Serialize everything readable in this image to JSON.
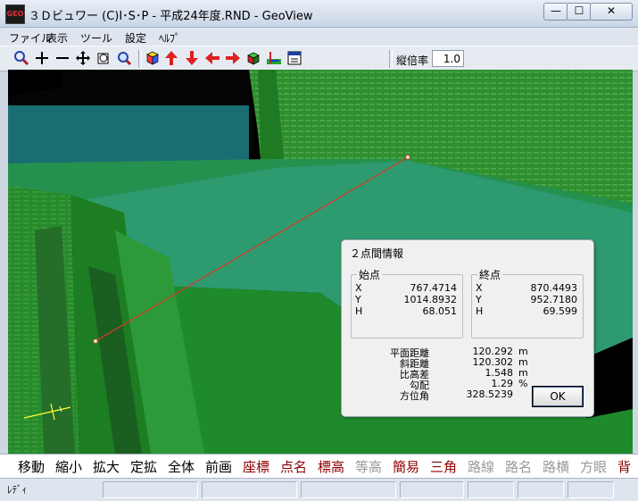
{
  "window": {
    "app_icon_text": "GEO",
    "title": "３Ｄビュワー (C)I･S･P - 平成24年度.RND - GeoView",
    "minimize": "—",
    "maximize": "☐",
    "close": "✕"
  },
  "menu": [
    "ファイル",
    "表示",
    "ツール",
    "設定",
    "ﾍﾙﾌﾟ"
  ],
  "toolbar": {
    "icons": [
      "zoom-icon",
      "plus-icon",
      "minus-icon",
      "pan-icon",
      "rotate-icon",
      "find-icon",
      "cube-icon",
      "arrow-up-icon",
      "arrow-down-icon",
      "arrow-left-icon",
      "arrow-right-icon",
      "box-icon",
      "axis-icon",
      "window-icon"
    ],
    "scale_label": "縦倍率",
    "scale_value": "1.0"
  },
  "dialog": {
    "title": "２点間情報",
    "start": {
      "label": "始点",
      "x_label": "X",
      "x": "767.4714",
      "y_label": "Y",
      "y": "1014.8932",
      "h_label": "H",
      "h": "68.051"
    },
    "end": {
      "label": "終点",
      "x_label": "X",
      "x": "870.4493",
      "y_label": "Y",
      "y": "952.7180",
      "h_label": "H",
      "h": "69.599"
    },
    "results": [
      {
        "label": "平面距離",
        "value": "120.292",
        "unit": "m"
      },
      {
        "label": "斜距離",
        "value": "120.302",
        "unit": "m"
      },
      {
        "label": "比高差",
        "value": "1.548",
        "unit": "m"
      },
      {
        "label": "勾配",
        "value": "1.29",
        "unit": "%"
      },
      {
        "label": "方位角",
        "value": "328.5239",
        "unit": ""
      }
    ],
    "ok": "OK"
  },
  "bottom_buttons": [
    {
      "label": "移動",
      "color": "#000000"
    },
    {
      "label": "縮小",
      "color": "#000000"
    },
    {
      "label": "拡大",
      "color": "#000000"
    },
    {
      "label": "定拡",
      "color": "#000000"
    },
    {
      "label": "全体",
      "color": "#000000"
    },
    {
      "label": "前画",
      "color": "#000000"
    },
    {
      "label": "座標",
      "color": "#8b0000"
    },
    {
      "label": "点名",
      "color": "#8b0000"
    },
    {
      "label": "標高",
      "color": "#8b0000"
    },
    {
      "label": "等高",
      "color": "#9a9a9a"
    },
    {
      "label": "簡易",
      "color": "#8b0000"
    },
    {
      "label": "三角",
      "color": "#8b0000"
    },
    {
      "label": "路線",
      "color": "#9a9a9a"
    },
    {
      "label": "路名",
      "color": "#9a9a9a"
    },
    {
      "label": "路横",
      "color": "#9a9a9a"
    },
    {
      "label": "方眼",
      "color": "#9a9a9a"
    },
    {
      "label": "背",
      "color": "#8b0000"
    }
  ],
  "status": {
    "text": "ﾚﾃﾞｨ"
  }
}
